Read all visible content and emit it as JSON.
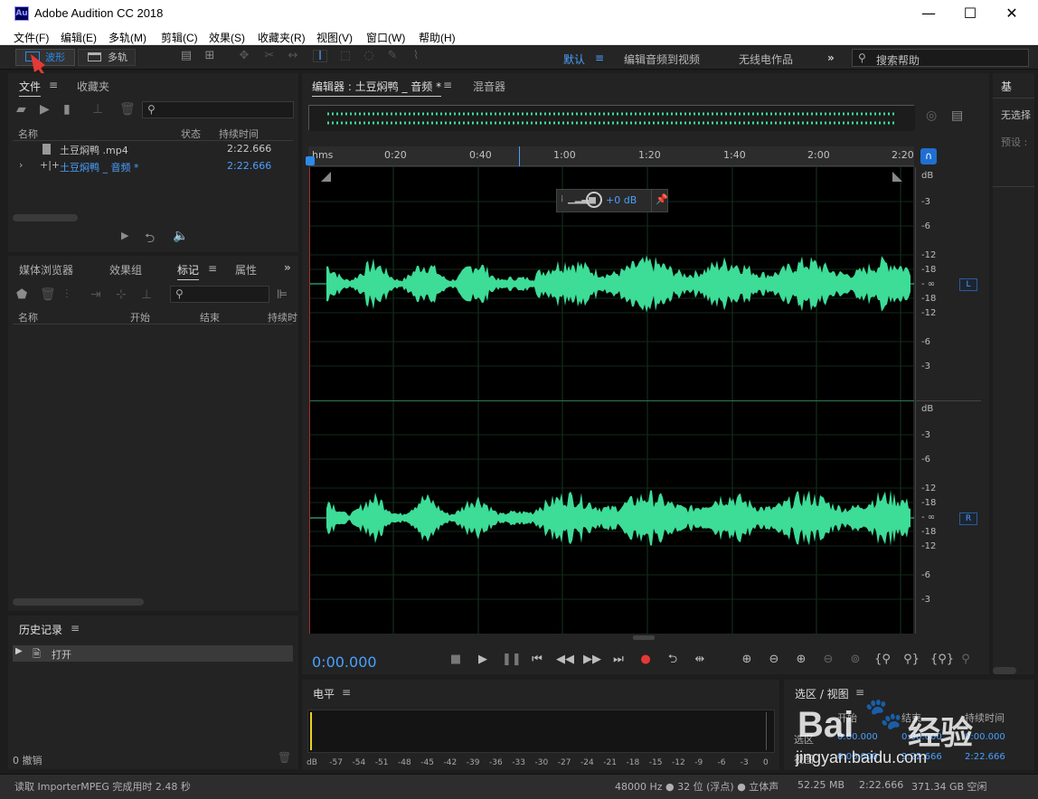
{
  "window": {
    "title": "Adobe Audition CC 2018",
    "icon_text": "Au",
    "minimize": "—",
    "maximize": "☐",
    "close": "✕"
  },
  "menu": [
    "文件(F)",
    "编辑(E)",
    "多轨(M)",
    "剪辑(C)",
    "效果(S)",
    "收藏夹(R)",
    "视图(V)",
    "窗口(W)",
    "帮助(H)"
  ],
  "toolbar": {
    "waveform_label": "波形",
    "multitrack_label": "多轨",
    "workspaces": [
      "默认",
      "编辑音频到视频",
      "无线电作品"
    ],
    "workspace_menu": "≡",
    "more": "»",
    "search_placeholder": "搜索帮助"
  },
  "files_panel": {
    "tabs": [
      "文件",
      "收藏夹"
    ],
    "menu_icon": "≡",
    "columns": [
      "名称",
      "状态",
      "持续时间"
    ],
    "rows": [
      {
        "name": "土豆焖鸭 .mp4",
        "duration": "2:22.666",
        "selected": false
      },
      {
        "name": "土豆焖鸭 _ 音频 *",
        "duration": "2:22.666",
        "selected": true
      }
    ]
  },
  "markers_panel": {
    "tabs": [
      "媒体浏览器",
      "效果组",
      "标记",
      "属性"
    ],
    "more": "»",
    "columns": [
      "名称",
      "开始",
      "结束",
      "持续时"
    ]
  },
  "history_panel": {
    "title": "历史记录",
    "items": [
      "打开"
    ],
    "undo_count": "0 撤销"
  },
  "editor": {
    "tabs": [
      "编辑器 : 土豆焖鸭 _ 音频 *",
      "混音器"
    ],
    "time_format": "hms",
    "ruler_ticks": [
      "0:20",
      "0:40",
      "1:00",
      "1:20",
      "1:40",
      "2:00",
      "2:20"
    ],
    "hud_gain": "+0 dB",
    "db_labels_top": [
      "dB",
      "-3",
      "-6",
      "-12",
      "-18",
      "- ∞",
      "-18",
      "-12",
      "-6",
      "-3"
    ],
    "db_labels_bottom": [
      "dB",
      "-3",
      "-6",
      "-12",
      "-18",
      "- ∞",
      "-18",
      "-12",
      "-6",
      "-3"
    ],
    "channel_left": "L",
    "channel_right": "R",
    "current_time": "0:00.000",
    "waveform_color": "#3ddc97"
  },
  "level_panel": {
    "title": "电平",
    "scale": [
      "dB",
      "-57",
      "-54",
      "-51",
      "-48",
      "-45",
      "-42",
      "-39",
      "-36",
      "-33",
      "-30",
      "-27",
      "-24",
      "-21",
      "-18",
      "-15",
      "-12",
      "-9",
      "-6",
      "-3",
      "0"
    ]
  },
  "selection_panel": {
    "title": "选区 / 视图",
    "columns": [
      "开始",
      "结束",
      "持续时间"
    ],
    "rows": [
      {
        "label": "选区",
        "start": "0:00.000",
        "end": "0:00.000",
        "duration": "0:00.000"
      },
      {
        "label": "视图",
        "start": "0:00.000",
        "end": "2:22.666",
        "duration": "2:22.666"
      }
    ]
  },
  "essential_panel": {
    "title": "基",
    "no_selection": "无选择",
    "preset": "预设 :"
  },
  "status": {
    "message": "读取 ImporterMPEG 完成用时 2.48 秒",
    "sample_info": "48000 Hz ● 32 位 (浮点) ● 立体声",
    "memory": "52.25 MB",
    "duration": "2:22.666",
    "disk_free": "371.34 GB 空闲"
  },
  "watermark": {
    "brand": "Bai",
    "brand_cn": "经验",
    "url": "jingyan.baidu.com"
  }
}
